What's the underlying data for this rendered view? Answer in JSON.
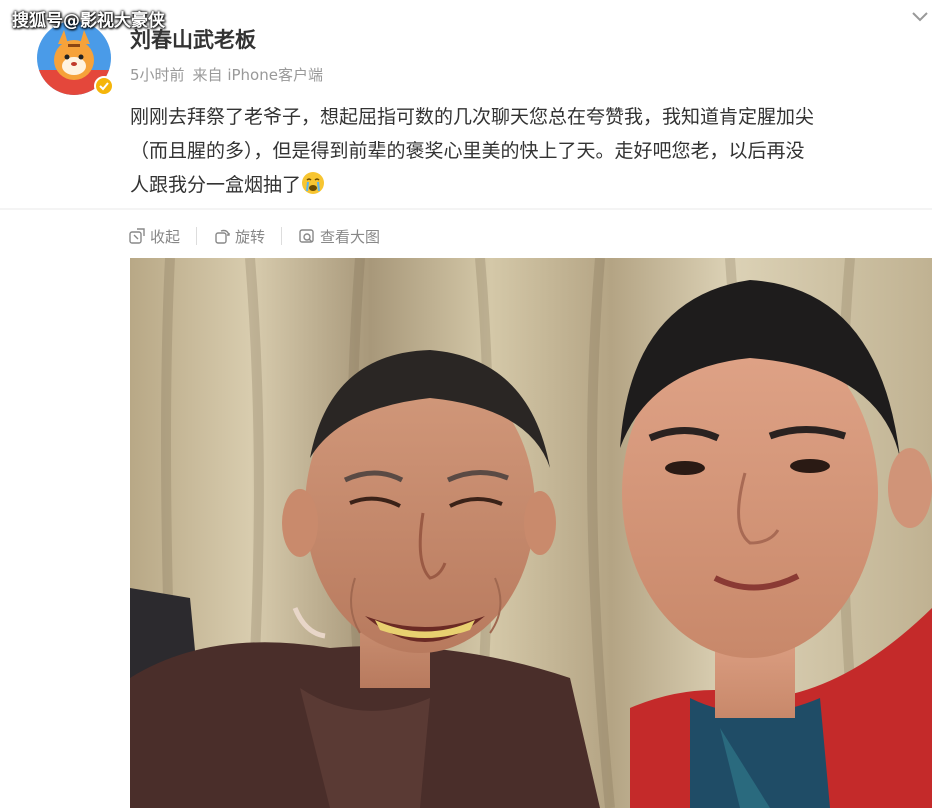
{
  "watermark": "搜狐号@影视大豪侠",
  "post": {
    "author": "刘春山武老板",
    "time": "5小时前",
    "source": "来自 iPhone客户端",
    "text_lines": [
      "刚刚去拜祭了老爷子，想起屈指可数的几次聊天您总在夸赞我，我知道肯定腥加尖",
      "（而且腥的多），但是得到前辈的褒奖心里美的快上了天。走好吧您老，以后再没",
      "人跟我分一盒烟抽了"
    ],
    "emoji": "crying-emoji"
  },
  "actions": {
    "collapse": "收起",
    "rotate": "旋转",
    "view_large": "查看大图"
  },
  "icons": [
    "chevron-down-icon",
    "collapse-icon",
    "rotate-icon",
    "view-large-icon",
    "verified-badge-icon"
  ],
  "colors": {
    "text": "#333333",
    "meta": "#999999",
    "verified": "#f5b50a"
  }
}
